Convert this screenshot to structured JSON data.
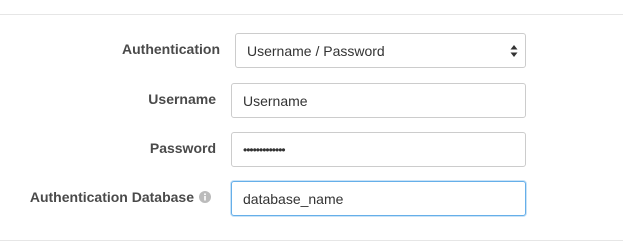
{
  "form": {
    "authentication": {
      "label": "Authentication",
      "selected": "Username / Password",
      "icon": "select-arrows-icon"
    },
    "username": {
      "label": "Username",
      "value": "Username"
    },
    "password": {
      "label": "Password",
      "value": "•••••••••••••"
    },
    "auth_database": {
      "label": "Authentication Database",
      "value": "database_name",
      "icon": "info-icon"
    }
  },
  "colors": {
    "label": "#4a4a4a",
    "input_border": "#cccccc",
    "focus_border": "#66afe9",
    "divider": "#e6e6e6",
    "info_icon": "#bbbbbb"
  }
}
